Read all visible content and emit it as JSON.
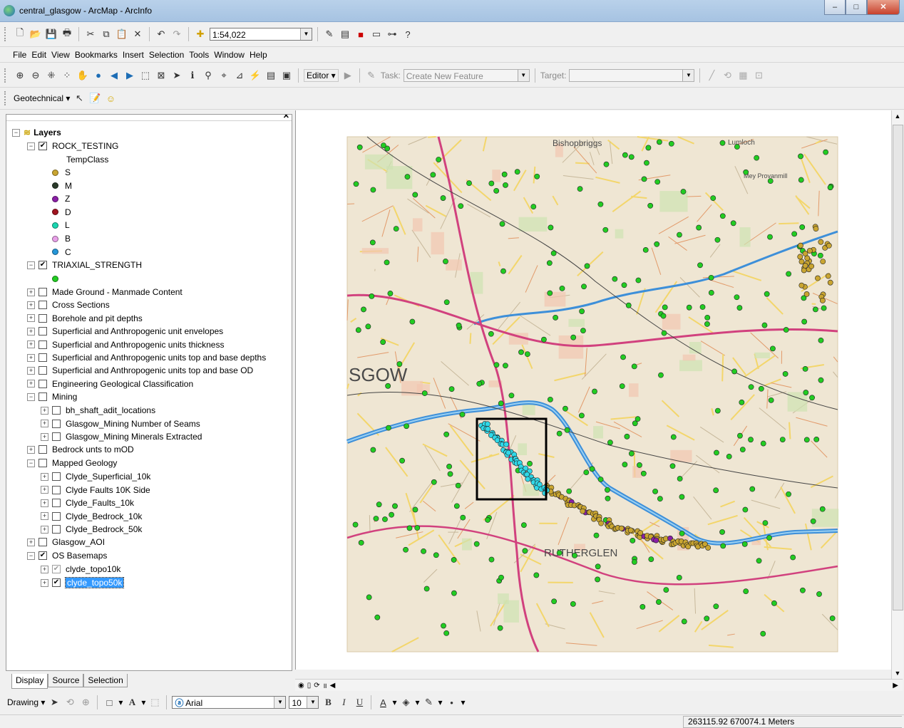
{
  "window": {
    "title": "central_glasgow - ArcMap - ArcInfo",
    "minimize": "–",
    "maximize": "□",
    "close": "✕"
  },
  "standard_toolbar": {
    "scale": "1:54,022"
  },
  "menu": [
    "File",
    "Edit",
    "View",
    "Bookmarks",
    "Insert",
    "Selection",
    "Tools",
    "Window",
    "Help"
  ],
  "editor_toolbar": {
    "editor_label": "Editor ▾",
    "task_label": "Task:",
    "task_value": "Create New Feature",
    "target_label": "Target:",
    "target_value": ""
  },
  "geotech_toolbar": {
    "label": "Geotechnical ▾"
  },
  "toc": {
    "root": "Layers",
    "rock_testing": "ROCK_TESTING",
    "temp_class": "TempClass",
    "classes": [
      {
        "label": "S",
        "color": "#c9a531"
      },
      {
        "label": "M",
        "color": "#2b3b2b"
      },
      {
        "label": "Z",
        "color": "#8a1fa6"
      },
      {
        "label": "D",
        "color": "#a01420"
      },
      {
        "label": "L",
        "color": "#19d6b0"
      },
      {
        "label": "B",
        "color": "#e8a0e8"
      },
      {
        "label": "C",
        "color": "#2596d8"
      }
    ],
    "triaxial": "TRIAXIAL_STRENGTH",
    "triaxial_color": "#22cc22",
    "groups": [
      "Made Ground - Manmade Content",
      "Cross Sections",
      "Borehole and pit depths",
      "Superficial and Anthropogenic unit envelopes",
      "Superficial and Anthropogenic units thickness",
      "Superficial and Anthropogenic units top and base depths",
      "Superficial and Anthropogenic units top and base OD",
      "Engineering Geological Classification"
    ],
    "mining": "Mining",
    "mining_children": [
      "bh_shaft_adit_locations",
      "Glasgow_Mining Number of Seams",
      "Glasgow_Mining Minerals Extracted"
    ],
    "bedrock": "Bedrock unts to mOD",
    "mapped_geology": "Mapped Geology",
    "geology_children": [
      "Clyde_Superficial_10k",
      "Clyde Faults 10K Side",
      "Clyde_Faults_10k",
      "Clyde_Bedrock_10k",
      "Clyde_Bedrock_50k"
    ],
    "aoi": "Glasgow_AOI",
    "os_basemaps": "OS Basemaps",
    "topo10k": "clyde_topo10k",
    "topo50k": "clyde_topo50k"
  },
  "tabs": [
    "Display",
    "Source",
    "Selection"
  ],
  "map": {
    "label_city": "SGOW",
    "label_town": "RUTHERGLEN",
    "label_north": "Bishopbriggs",
    "label_lumloch": "Lumloch",
    "label_provan": "Mey Provanmill"
  },
  "drawing_toolbar": {
    "drawing_label": "Drawing ▾",
    "font": "Arial",
    "size": "10"
  },
  "status": {
    "coords": "263115.92  670074.1 Meters"
  }
}
